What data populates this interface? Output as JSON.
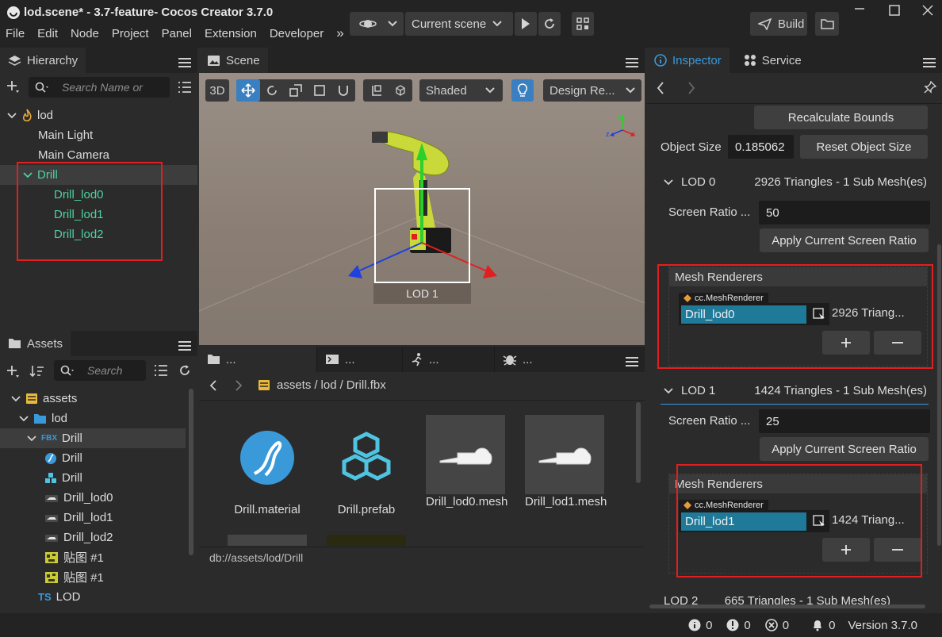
{
  "window": {
    "title": "lod.scene* - 3.7-feature- Cocos Creator 3.7.0",
    "menu": [
      "File",
      "Edit",
      "Node",
      "Project",
      "Panel",
      "Extension",
      "Developer"
    ],
    "more": "»",
    "scene_selector": "Current scene",
    "build_label": "Build"
  },
  "hierarchy": {
    "tab_label": "Hierarchy",
    "search_placeholder": "Search Name or",
    "root": "lod",
    "items": [
      "Main Light",
      "Main Camera"
    ],
    "selected": "Drill",
    "children": [
      "Drill_lod0",
      "Drill_lod1",
      "Drill_lod2"
    ]
  },
  "assets": {
    "tab_label": "Assets",
    "search_placeholder": "Search",
    "tree": [
      "assets",
      "lod",
      "Drill",
      "Drill",
      "Drill",
      "Drill_lod0",
      "Drill_lod1",
      "Drill_lod2",
      "贴图 #1",
      "贴图 #1",
      "LOD"
    ],
    "fbx_badge": "FBX",
    "ts_badge": "TS"
  },
  "scene": {
    "tab_label": "Scene",
    "mode_3d": "3D",
    "shading": "Shaded",
    "design_resolution": "Design Re...",
    "lod_badge": "LOD 1",
    "gizmo_axes": {
      "x": "x",
      "y": "y",
      "z": "z"
    }
  },
  "browser": {
    "tabs": [
      "...",
      "...",
      "...",
      "..."
    ],
    "breadcrumb": [
      "assets",
      "lod",
      "Drill.fbx"
    ],
    "items": [
      {
        "label": "Drill.material"
      },
      {
        "label": "Drill.prefab"
      },
      {
        "label": "Drill_lod0.mesh"
      },
      {
        "label": "Drill_lod1.mesh"
      }
    ],
    "status_path": "db://assets/lod/Drill"
  },
  "inspector": {
    "tab_label": "Inspector",
    "service_label": "Service",
    "recalc_label": "Recalculate Bounds",
    "object_size_label": "Object Size",
    "object_size_value": "0.185062",
    "reset_size_label": "Reset Object Size",
    "lods": [
      {
        "title": "LOD 0",
        "summary": "2926 Triangles - 1 Sub Mesh(es)",
        "screen_ratio_label": "Screen Ratio ...",
        "screen_ratio_value": "50",
        "apply_label": "Apply Current Screen Ratio",
        "renderers_label": "Mesh Renderers",
        "component_tag": "cc.MeshRenderer",
        "renderer_value": "Drill_lod0",
        "renderer_info": "2926 Triang..."
      },
      {
        "title": "LOD 1",
        "summary": "1424 Triangles - 1 Sub Mesh(es)",
        "screen_ratio_label": "Screen Ratio ...",
        "screen_ratio_value": "25",
        "apply_label": "Apply Current Screen Ratio",
        "renderers_label": "Mesh Renderers",
        "component_tag": "cc.MeshRenderer",
        "renderer_value": "Drill_lod1",
        "renderer_info": "1424 Triang..."
      }
    ],
    "next_lod_partial": "LOD 2        665 Triangles - 1 Sub Mesh(es)"
  },
  "statusbar": {
    "info_count": "0",
    "warn_count": "0",
    "error_count": "0",
    "notify_count": "0",
    "version": "Version 3.7.0"
  },
  "colors": {
    "accent": "#4fd1a0",
    "selection_blue": "#1f7a9a",
    "highlight_red": "#e02020",
    "tab_blue": "#3a9ad9"
  }
}
